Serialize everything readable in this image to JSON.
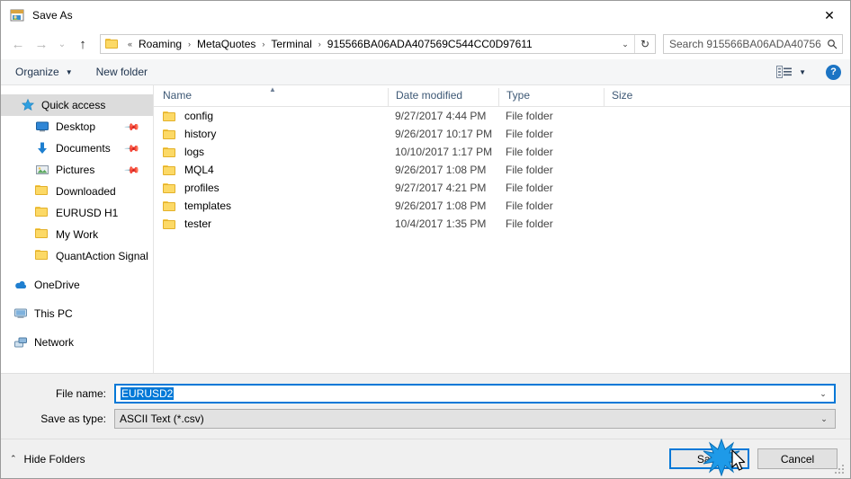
{
  "window": {
    "title": "Save As",
    "icon": "save-as-icon",
    "close_label": "✕"
  },
  "nav": {
    "back": "←",
    "forward": "→",
    "recent": "⌄",
    "up": "↑",
    "refresh": "↻",
    "dropdown": "⌄"
  },
  "address": {
    "prefix": "«",
    "crumbs": [
      "Roaming",
      "MetaQuotes",
      "Terminal",
      "915566BA06ADA407569C544CC0D97611"
    ],
    "separator": "›"
  },
  "search": {
    "placeholder": "Search 915566BA06ADA40756...",
    "icon": "magnifier-icon"
  },
  "toolbar": {
    "organize_label": "Organize",
    "organize_caret": "▼",
    "new_folder_label": "New folder",
    "view_caret": "▼",
    "help_label": "?"
  },
  "sidebar": {
    "items": [
      {
        "label": "Quick access",
        "icon": "star-icon",
        "level": "root",
        "selected": true,
        "pinned": false
      },
      {
        "label": "Desktop",
        "icon": "desktop-icon",
        "level": "child",
        "selected": false,
        "pinned": true
      },
      {
        "label": "Documents",
        "icon": "documents-icon",
        "level": "child",
        "selected": false,
        "pinned": true
      },
      {
        "label": "Pictures",
        "icon": "pictures-icon",
        "level": "child",
        "selected": false,
        "pinned": true
      },
      {
        "label": "Downloaded",
        "icon": "folder-icon",
        "level": "child",
        "selected": false,
        "pinned": false
      },
      {
        "label": "EURUSD H1",
        "icon": "folder-icon",
        "level": "child",
        "selected": false,
        "pinned": false
      },
      {
        "label": "My Work",
        "icon": "folder-icon",
        "level": "child",
        "selected": false,
        "pinned": false
      },
      {
        "label": "QuantAction Signal",
        "icon": "folder-icon",
        "level": "child",
        "selected": false,
        "pinned": false
      },
      {
        "label": "OneDrive",
        "icon": "onedrive-icon",
        "level": "group",
        "selected": false,
        "pinned": false
      },
      {
        "label": "This PC",
        "icon": "thispc-icon",
        "level": "group",
        "selected": false,
        "pinned": false
      },
      {
        "label": "Network",
        "icon": "network-icon",
        "level": "group",
        "selected": false,
        "pinned": false
      }
    ],
    "pin_glyph": "📌"
  },
  "filelist": {
    "sort_indicator": "▲",
    "columns": [
      "Name",
      "Date modified",
      "Type",
      "Size"
    ],
    "rows": [
      {
        "name": "config",
        "date": "9/27/2017 4:44 PM",
        "type": "File folder",
        "size": ""
      },
      {
        "name": "history",
        "date": "9/26/2017 10:17 PM",
        "type": "File folder",
        "size": ""
      },
      {
        "name": "logs",
        "date": "10/10/2017 1:17 PM",
        "type": "File folder",
        "size": ""
      },
      {
        "name": "MQL4",
        "date": "9/26/2017 1:08 PM",
        "type": "File folder",
        "size": ""
      },
      {
        "name": "profiles",
        "date": "9/27/2017 4:21 PM",
        "type": "File folder",
        "size": ""
      },
      {
        "name": "templates",
        "date": "9/26/2017 1:08 PM",
        "type": "File folder",
        "size": ""
      },
      {
        "name": "tester",
        "date": "10/4/2017 1:35 PM",
        "type": "File folder",
        "size": ""
      }
    ]
  },
  "form": {
    "filename_label": "File name:",
    "filename_value": "EURUSD2",
    "filetype_label": "Save as type:",
    "filetype_value": "ASCII Text (*.csv)",
    "arrow": "⌄"
  },
  "footer": {
    "hide_folders_label": "Hide Folders",
    "hide_folders_chev": "⌃",
    "save_label": "Save",
    "cancel_label": "Cancel"
  },
  "colors": {
    "accent": "#0078d7",
    "folder": "#fcd966",
    "header_text": "#3d5875",
    "selection": "#dcdcdc"
  }
}
